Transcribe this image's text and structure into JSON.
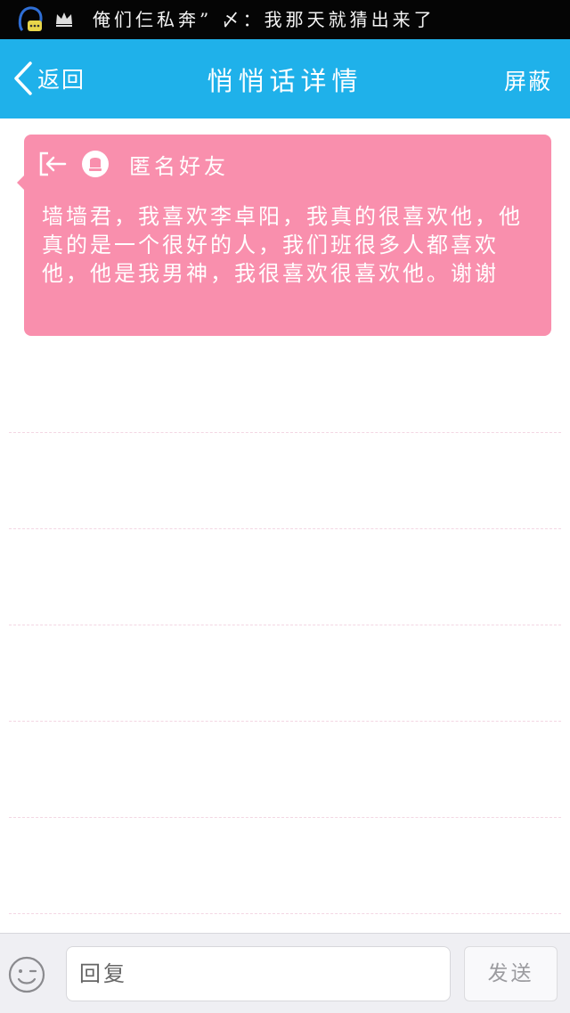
{
  "status_bar": {
    "notification_text": "俺们仨私奔” 〆：我那天就猜出来了"
  },
  "header": {
    "back_label": "返回",
    "title": "悄悄话详情",
    "block_label": "屏蔽"
  },
  "message": {
    "sender": "匿名好友",
    "body": "墙墙君，我喜欢李卓阳，我真的很喜欢他，他真的是一个很好的人，我们班很多人都喜欢他，他是我男神，我很喜欢很喜欢他。谢谢",
    "bubble_color": "#f98fad"
  },
  "reply_bar": {
    "input_placeholder": "回复",
    "send_label": "发送"
  },
  "colors": {
    "header_bg": "#1fb1ea",
    "status_bg": "#050505",
    "accent_pink": "#f98fad"
  },
  "icons": {
    "back": "chevron-left-icon",
    "exit": "exit-icon",
    "anonymous_avatar": "anonymous-user-icon",
    "emoji": "emoji-icon",
    "crown": "crown-icon",
    "chat_avatar": "chat-bubble-avatar-icon"
  }
}
